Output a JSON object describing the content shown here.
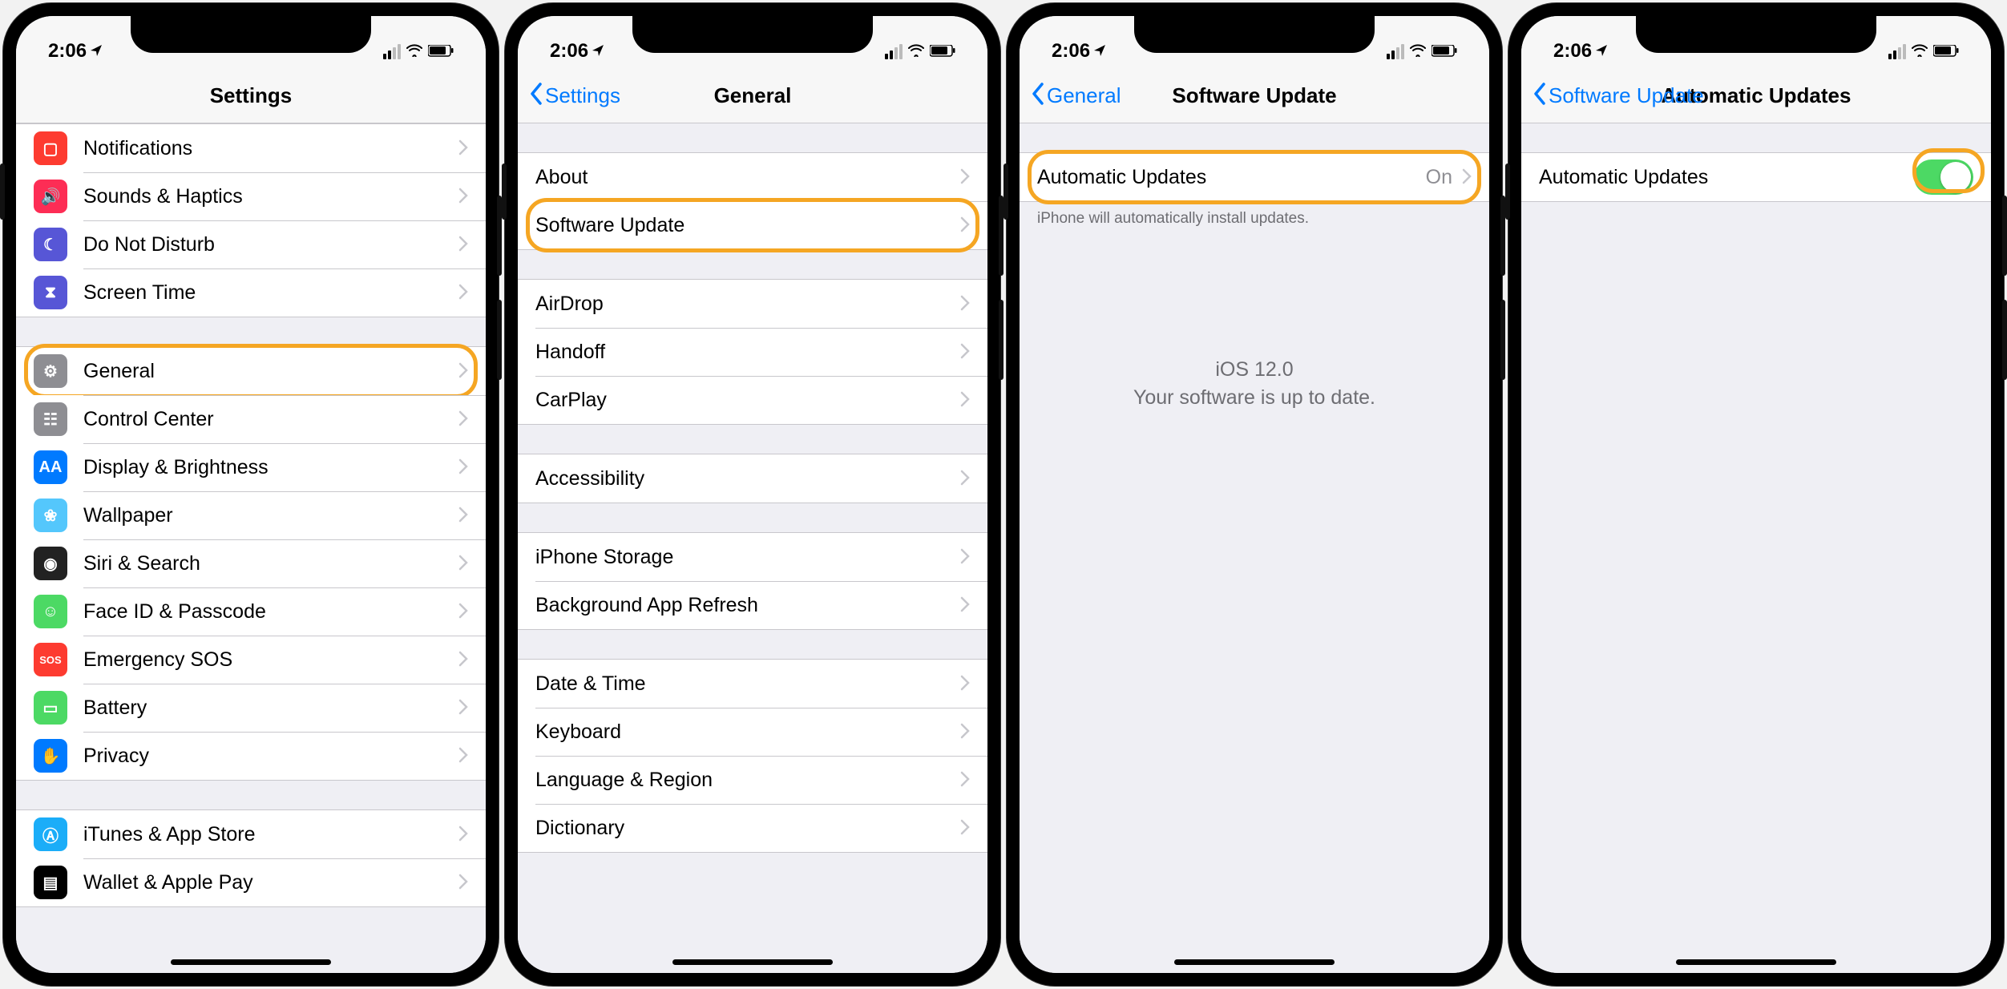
{
  "status": {
    "time": "2:06",
    "location_icon": "location-arrow",
    "signal": 2,
    "wifi": true,
    "battery_pct": 80
  },
  "highlight_color": "#f5a623",
  "screens": [
    {
      "back": null,
      "title": "Settings",
      "groups": [
        {
          "rows": [
            {
              "id": "notifications",
              "icon": "notifications-icon",
              "icon_bg": "#fd3b30",
              "label": "Notifications"
            },
            {
              "id": "sounds",
              "icon": "sounds-icon",
              "icon_bg": "#fd2d55",
              "label": "Sounds & Haptics"
            },
            {
              "id": "dnd",
              "icon": "moon-icon",
              "icon_bg": "#5756d6",
              "label": "Do Not Disturb"
            },
            {
              "id": "screentime",
              "icon": "hourglass-icon",
              "icon_bg": "#5756d6",
              "label": "Screen Time"
            }
          ]
        },
        {
          "rows": [
            {
              "id": "general",
              "icon": "gear-icon",
              "icon_bg": "#8e8e93",
              "label": "General",
              "highlight": true
            },
            {
              "id": "controlcenter",
              "icon": "sliders-icon",
              "icon_bg": "#8e8e93",
              "label": "Control Center"
            },
            {
              "id": "display",
              "icon": "aa-icon",
              "icon_bg": "#007aff",
              "label": "Display & Brightness"
            },
            {
              "id": "wallpaper",
              "icon": "flower-icon",
              "icon_bg": "#54c7fc",
              "label": "Wallpaper"
            },
            {
              "id": "siri",
              "icon": "siri-icon",
              "icon_bg": "#222",
              "label": "Siri & Search"
            },
            {
              "id": "faceid",
              "icon": "face-icon",
              "icon_bg": "#4cd964",
              "label": "Face ID & Passcode"
            },
            {
              "id": "sos",
              "icon": "sos-icon",
              "icon_bg": "#fd3b30",
              "label": "Emergency SOS"
            },
            {
              "id": "battery",
              "icon": "battery-icon",
              "icon_bg": "#4cd964",
              "label": "Battery"
            },
            {
              "id": "privacy",
              "icon": "hand-icon",
              "icon_bg": "#007aff",
              "label": "Privacy"
            }
          ]
        },
        {
          "rows": [
            {
              "id": "appstore",
              "icon": "appstore-icon",
              "icon_bg": "#1badf8",
              "label": "iTunes & App Store"
            },
            {
              "id": "wallet",
              "icon": "wallet-icon",
              "icon_bg": "#000",
              "label": "Wallet & Apple Pay"
            }
          ]
        }
      ]
    },
    {
      "back": "Settings",
      "title": "General",
      "groups": [
        {
          "rows": [
            {
              "id": "about",
              "label": "About"
            },
            {
              "id": "swupdate",
              "label": "Software Update",
              "highlight": true
            }
          ]
        },
        {
          "rows": [
            {
              "id": "airdrop",
              "label": "AirDrop"
            },
            {
              "id": "handoff",
              "label": "Handoff"
            },
            {
              "id": "carplay",
              "label": "CarPlay"
            }
          ]
        },
        {
          "rows": [
            {
              "id": "accessibility",
              "label": "Accessibility"
            }
          ]
        },
        {
          "rows": [
            {
              "id": "storage",
              "label": "iPhone Storage"
            },
            {
              "id": "bgrefresh",
              "label": "Background App Refresh"
            }
          ]
        },
        {
          "rows": [
            {
              "id": "datetime",
              "label": "Date & Time"
            },
            {
              "id": "keyboard",
              "label": "Keyboard"
            },
            {
              "id": "language",
              "label": "Language & Region"
            },
            {
              "id": "dictionary",
              "label": "Dictionary"
            }
          ]
        }
      ]
    },
    {
      "back": "General",
      "title": "Software Update",
      "groups": [
        {
          "rows": [
            {
              "id": "autoupdates",
              "label": "Automatic Updates",
              "detail": "On",
              "highlight": true
            }
          ],
          "footer": "iPhone will automatically install updates."
        }
      ],
      "center_message": {
        "line1": "iOS 12.0",
        "line2": "Your software is up to date."
      }
    },
    {
      "back": "Software Update",
      "title": "Automatic Updates",
      "groups": [
        {
          "rows": [
            {
              "id": "autoupdates-toggle",
              "label": "Automatic Updates",
              "toggle": true,
              "toggle_on": true,
              "highlight_toggle": true
            }
          ]
        }
      ]
    }
  ],
  "icon_glyphs": {
    "notifications-icon": "▢",
    "sounds-icon": "🔊",
    "moon-icon": "☾",
    "hourglass-icon": "⧗",
    "gear-icon": "⚙",
    "sliders-icon": "☷",
    "aa-icon": "AA",
    "flower-icon": "❀",
    "siri-icon": "◉",
    "face-icon": "☺",
    "sos-icon": "SOS",
    "battery-icon": "▭",
    "hand-icon": "✋",
    "appstore-icon": "Ⓐ",
    "wallet-icon": "▤"
  }
}
